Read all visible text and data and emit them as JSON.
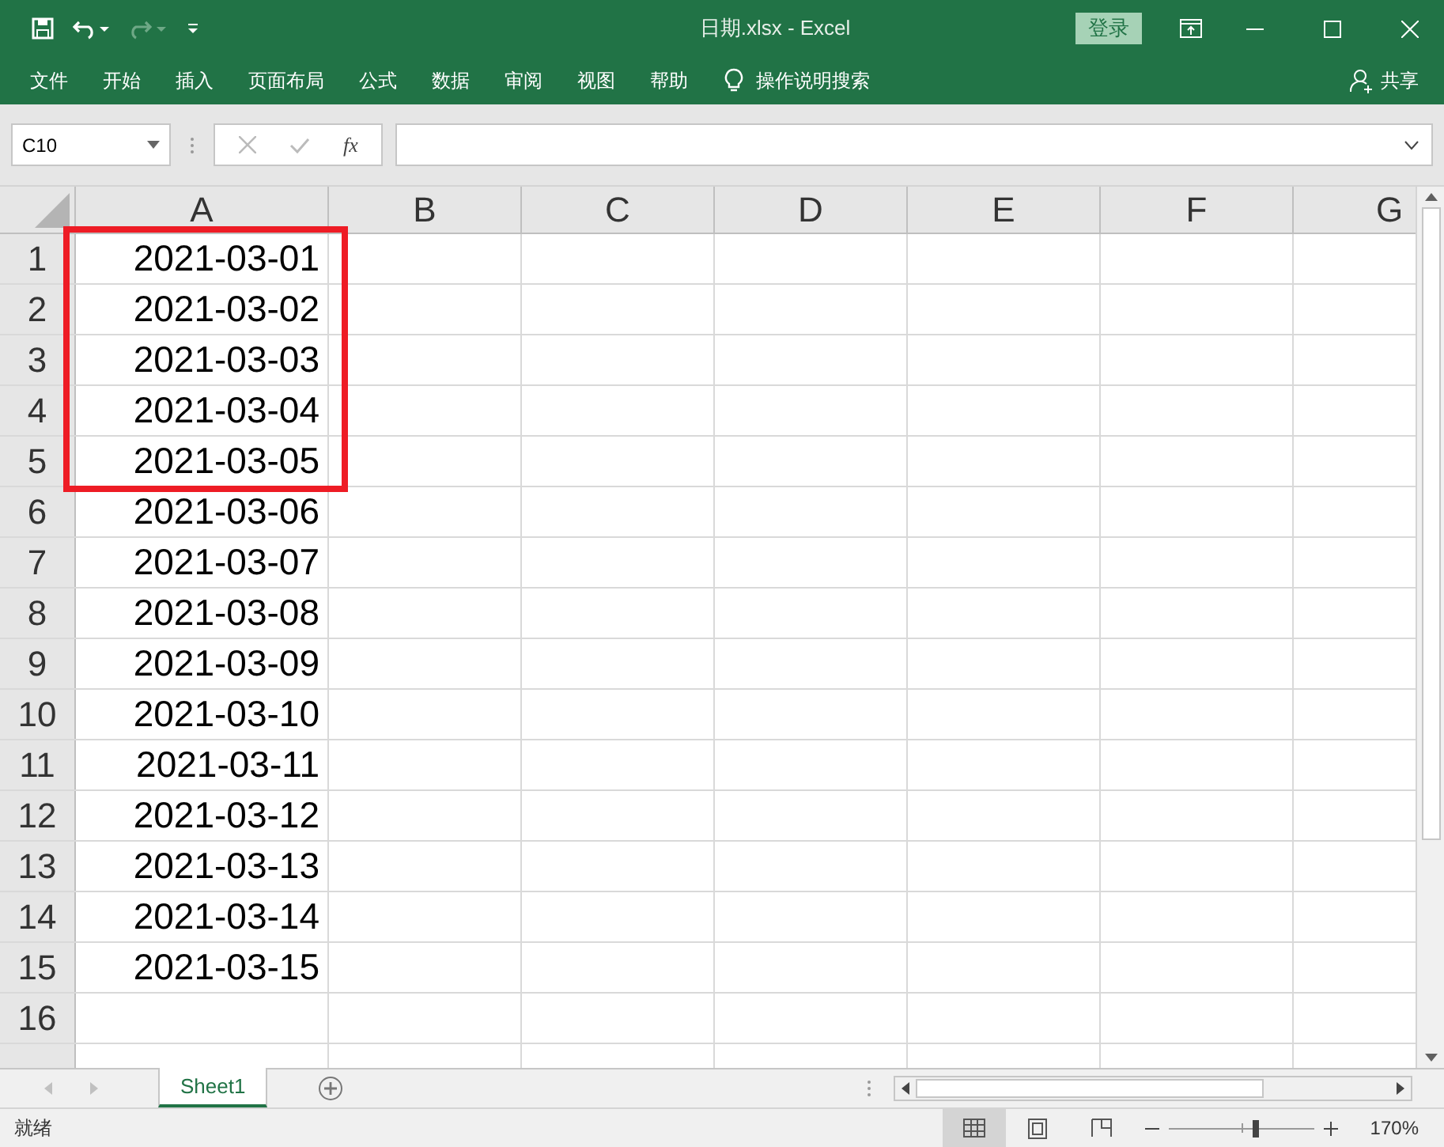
{
  "window": {
    "title": "日期.xlsx  -  Excel",
    "login": "登录"
  },
  "ribbon_tabs": [
    {
      "label": "文件"
    },
    {
      "label": "开始"
    },
    {
      "label": "插入"
    },
    {
      "label": "页面布局"
    },
    {
      "label": "公式"
    },
    {
      "label": "数据"
    },
    {
      "label": "审阅"
    },
    {
      "label": "视图"
    },
    {
      "label": "帮助"
    }
  ],
  "tell_me": "操作说明搜索",
  "share": "共享",
  "formula_bar": {
    "name_box": "C10",
    "fx": "fx"
  },
  "columns": [
    "A",
    "B",
    "C",
    "D",
    "E",
    "F",
    "G"
  ],
  "rows": [
    {
      "number": "1",
      "value": "2021-03-01",
      "highlighted": true
    },
    {
      "number": "2",
      "value": "2021-03-02",
      "highlighted": true
    },
    {
      "number": "3",
      "value": "2021-03-03",
      "highlighted": true
    },
    {
      "number": "4",
      "value": "2021-03-04",
      "highlighted": true
    },
    {
      "number": "5",
      "value": "2021-03-05",
      "highlighted": true
    },
    {
      "number": "6",
      "value": "2021-03-06",
      "highlighted": false
    },
    {
      "number": "7",
      "value": "2021-03-07",
      "highlighted": false
    },
    {
      "number": "8",
      "value": "2021-03-08",
      "highlighted": false
    },
    {
      "number": "9",
      "value": "2021-03-09",
      "highlighted": false
    },
    {
      "number": "10",
      "value": "2021-03-10",
      "highlighted": false
    },
    {
      "number": "11",
      "value": "2021-03-11",
      "highlighted": false
    },
    {
      "number": "12",
      "value": "2021-03-12",
      "highlighted": false
    },
    {
      "number": "13",
      "value": "2021-03-13",
      "highlighted": false
    },
    {
      "number": "14",
      "value": "2021-03-14",
      "highlighted": false
    },
    {
      "number": "15",
      "value": "2021-03-15",
      "highlighted": false
    },
    {
      "number": "16",
      "value": "",
      "highlighted": false
    }
  ],
  "sheet_tabs": [
    {
      "label": "Sheet1",
      "selected": true
    }
  ],
  "status_bar": {
    "status": "就绪",
    "zoom": "170%",
    "zoom_slider": {
      "level": 0.6
    }
  }
}
